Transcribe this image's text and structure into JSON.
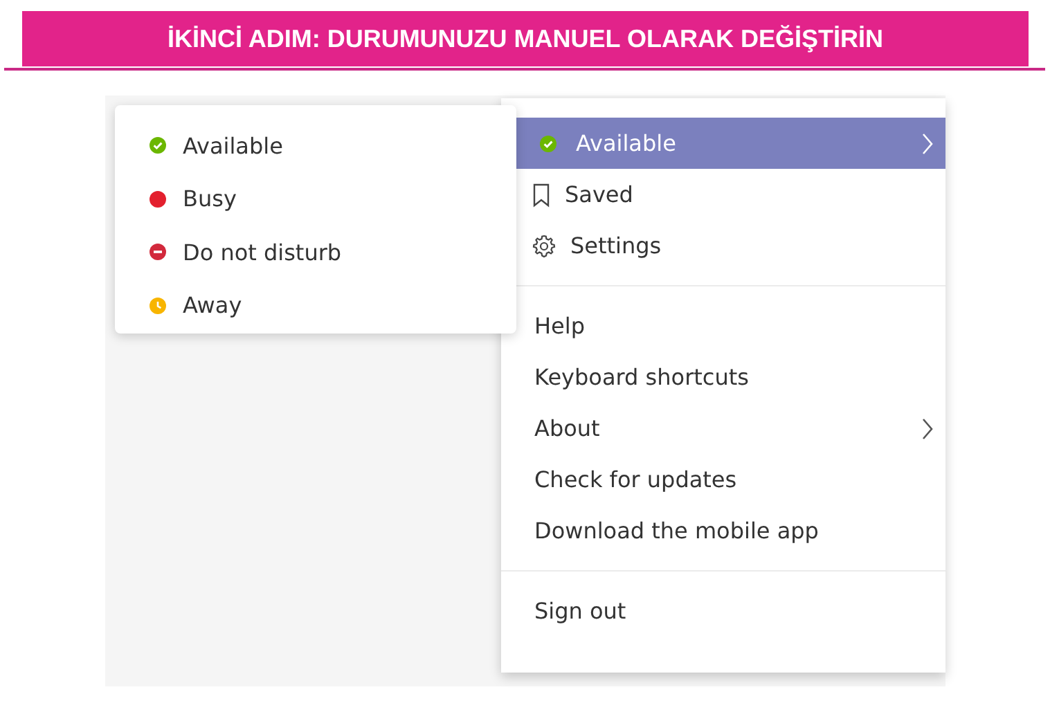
{
  "banner": {
    "title": "İKİNCİ ADIM: DURUMUNUZU MANUEL OLARAK DEĞİŞTİRİN"
  },
  "status_menu": {
    "items": [
      {
        "label": "Available",
        "kind": "check",
        "color": "#6bb700"
      },
      {
        "label": "Busy",
        "kind": "dot",
        "color": "#e3202e"
      },
      {
        "label": "Do not disturb",
        "kind": "minus",
        "color": "#d2293c"
      },
      {
        "label": "Away",
        "kind": "clock",
        "color": "#f8b500"
      }
    ]
  },
  "main_menu": {
    "sections": [
      {
        "items": [
          {
            "label": "Available",
            "kind": "status",
            "selected": true,
            "submenu": true
          },
          {
            "label": "Saved",
            "kind": "bookmark",
            "selected": false,
            "submenu": false
          },
          {
            "label": "Settings",
            "kind": "gear",
            "selected": false,
            "submenu": false
          }
        ]
      },
      {
        "items": [
          {
            "label": "Help",
            "kind": "plain",
            "selected": false,
            "submenu": false
          },
          {
            "label": "Keyboard shortcuts",
            "kind": "plain",
            "selected": false,
            "submenu": false
          },
          {
            "label": "About",
            "kind": "plain",
            "selected": false,
            "submenu": true
          },
          {
            "label": "Check for updates",
            "kind": "plain",
            "selected": false,
            "submenu": false
          },
          {
            "label": "Download the mobile app",
            "kind": "plain",
            "selected": false,
            "submenu": false
          }
        ]
      },
      {
        "items": [
          {
            "label": "Sign out",
            "kind": "plain",
            "selected": false,
            "submenu": false
          }
        ]
      }
    ]
  }
}
